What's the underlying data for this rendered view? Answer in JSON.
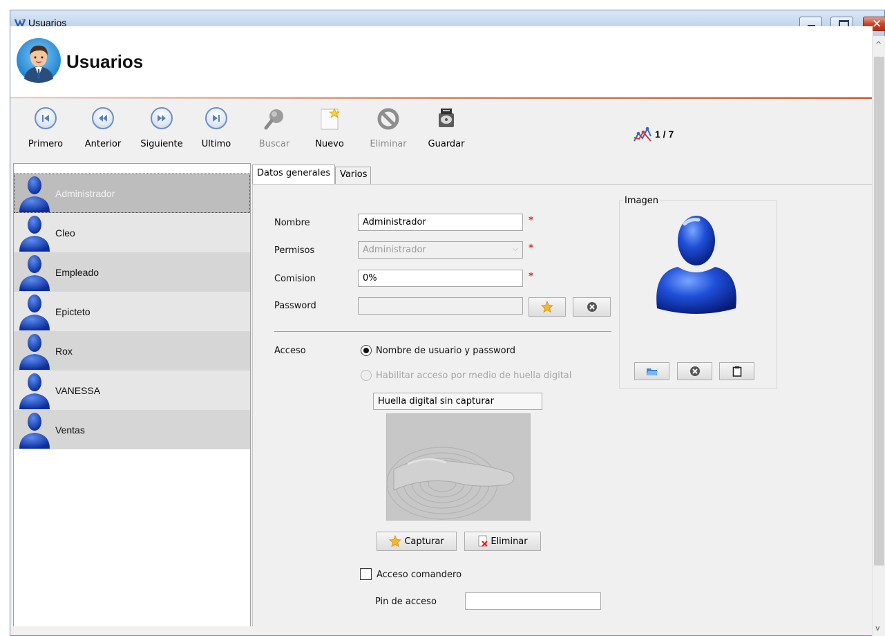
{
  "window": {
    "title": "Usuarios"
  },
  "header": {
    "title": "Usuarios"
  },
  "toolbar": {
    "primero": "Primero",
    "anterior": "Anterior",
    "siguiente": "Siguiente",
    "ultimo": "Ultimo",
    "buscar": "Buscar",
    "nuevo": "Nuevo",
    "eliminar": "Eliminar",
    "guardar": "Guardar",
    "counter": "1 / 7"
  },
  "users": [
    {
      "name": "Administrador",
      "selected": true
    },
    {
      "name": "Cleo"
    },
    {
      "name": "Empleado"
    },
    {
      "name": "Epicteto"
    },
    {
      "name": "Rox"
    },
    {
      "name": "VANESSA"
    },
    {
      "name": "Ventas"
    }
  ],
  "tabs": {
    "general": "Datos generales",
    "varios": "Varios"
  },
  "form": {
    "nombre_label": "Nombre",
    "nombre_value": "Administrador",
    "permisos_label": "Permisos",
    "permisos_value": "Administrador",
    "comision_label": "Comision",
    "comision_value": "0%",
    "password_label": "Password",
    "password_value": "",
    "required_mark": "*",
    "acceso_label": "Acceso",
    "acceso_option1": "Nombre de usuario y password",
    "acceso_option2": "Habilitar acceso por medio de huella digital",
    "huella_status": "Huella digital sin capturar",
    "capturar": "Capturar",
    "eliminar": "Eliminar",
    "acceso_comandero": "Acceso comandero",
    "pin_label": "Pin de acceso",
    "pin_value": ""
  },
  "imagen": {
    "legend": "Imagen"
  },
  "colors": {
    "selected_row": "#bdbdbd",
    "header_accent": "#c95d32",
    "avatar_blue": "#1f4fb8",
    "required": "#e03030"
  }
}
